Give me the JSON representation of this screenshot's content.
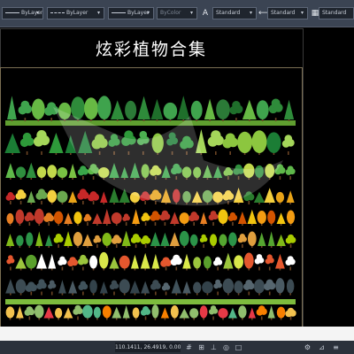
{
  "toolbar": {
    "layer_label": "ByLayer",
    "linetype_label": "ByLayer",
    "lineweight_label": "ByLayer",
    "color_label": "ByColor",
    "text_style": "Standard",
    "dim_style": "Standard",
    "table_style": "Standard",
    "icons": [
      "text-style-icon",
      "dim-style-icon",
      "table-style-icon"
    ]
  },
  "drawing": {
    "title": "炫彩植物合集"
  },
  "statusbar": {
    "coordinates": "110.1411, 26.4919, 0.0000",
    "icons": [
      "grid-icon",
      "snap-icon",
      "ortho-icon",
      "polar-icon",
      "osnap-icon",
      "workspace-icon",
      "annotation-icon",
      "settings-icon"
    ]
  },
  "colors": {
    "canvas": "#000000",
    "toolbar": "#3b4453",
    "frame": "#7a6e52",
    "ground": "#7dbb3d"
  }
}
